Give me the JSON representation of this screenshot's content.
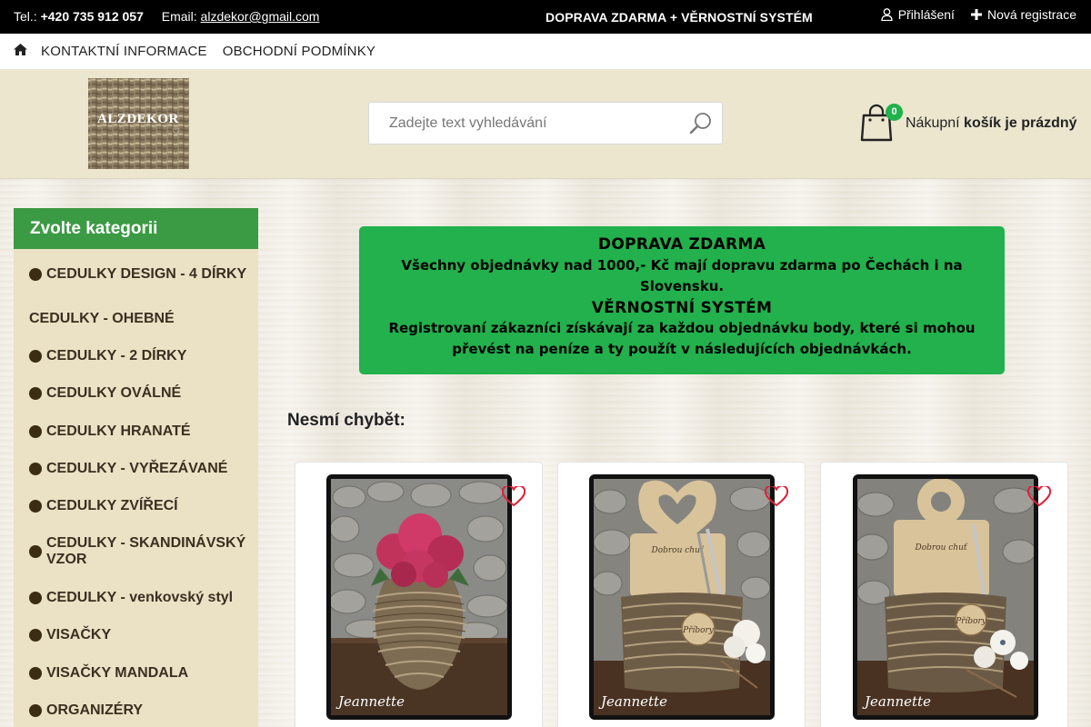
{
  "topbar": {
    "phone_label": "Tel.:",
    "phone": "+420 735 912 057",
    "email_label": "Email:",
    "email": "alzdekor@gmail.com",
    "promo": "DOPRAVA ZDARMA + VĚRNOSTNÍ SYSTÉM",
    "login": "Přihlášení",
    "register": "Nová registrace"
  },
  "nav": {
    "links": [
      "KONTAKTNÍ INFORMACE",
      "OBCHODNÍ PODMÍNKY"
    ]
  },
  "header": {
    "logo_text": "ALZDEKOR",
    "search_placeholder": "Zadejte text vyhledávání",
    "cart_count": "0",
    "cart_label": "Nákupní",
    "cart_status": "košík je prázdný"
  },
  "sidebar": {
    "title": "Zvolte kategorii",
    "items": [
      {
        "label": "CEDULKY DESIGN - 4 DÍRKY",
        "bullet": true
      },
      {
        "label": "CEDULKY - OHEBNÉ",
        "bullet": false
      },
      {
        "label": "CEDULKY - 2 DÍRKY",
        "bullet": true
      },
      {
        "label": "CEDULKY OVÁLNÉ",
        "bullet": true
      },
      {
        "label": "CEDULKY HRANATÉ",
        "bullet": true
      },
      {
        "label": "CEDULKY - VYŘEZÁVANÉ",
        "bullet": true
      },
      {
        "label": "CEDULKY ZVÍŘECÍ",
        "bullet": true
      },
      {
        "label": "CEDULKY - SKANDINÁVSKÝ VZOR",
        "bullet": true
      },
      {
        "label": "CEDULKY - venkovský styl",
        "bullet": true
      },
      {
        "label": "VISAČKY",
        "bullet": true
      },
      {
        "label": "VISAČKY MANDALA",
        "bullet": true
      },
      {
        "label": "ORGANIZÉRY",
        "bullet": true
      }
    ]
  },
  "banner": {
    "title1": "DOPRAVA ZDARMA",
    "text1": "Všechny objednávky nad 1000,- Kč mají dopravu zdarma po Čechách i na Slovensku.",
    "title2": "VĚRNOSTNÍ SYSTÉM",
    "text2": "Registrovaní zákazníci získávají za každou objednávku body, které si mohou převést na peníze a ty použít v následujících objednávkách."
  },
  "section": {
    "title": "Nesmí chybět:"
  },
  "products": [
    {
      "signature": "Jeannette",
      "tag_text": ""
    },
    {
      "signature": "Jeannette",
      "tag_text": "Příbory",
      "board_text": "Dobrou chuť"
    },
    {
      "signature": "Jeannette",
      "tag_text": "Příbory",
      "board_text": "Dobrou chuť"
    }
  ],
  "colors": {
    "accent_green": "#3b9a44",
    "banner_green": "#22b14c",
    "badge_green": "#20b24b",
    "wishlist_red": "#e0203a"
  }
}
